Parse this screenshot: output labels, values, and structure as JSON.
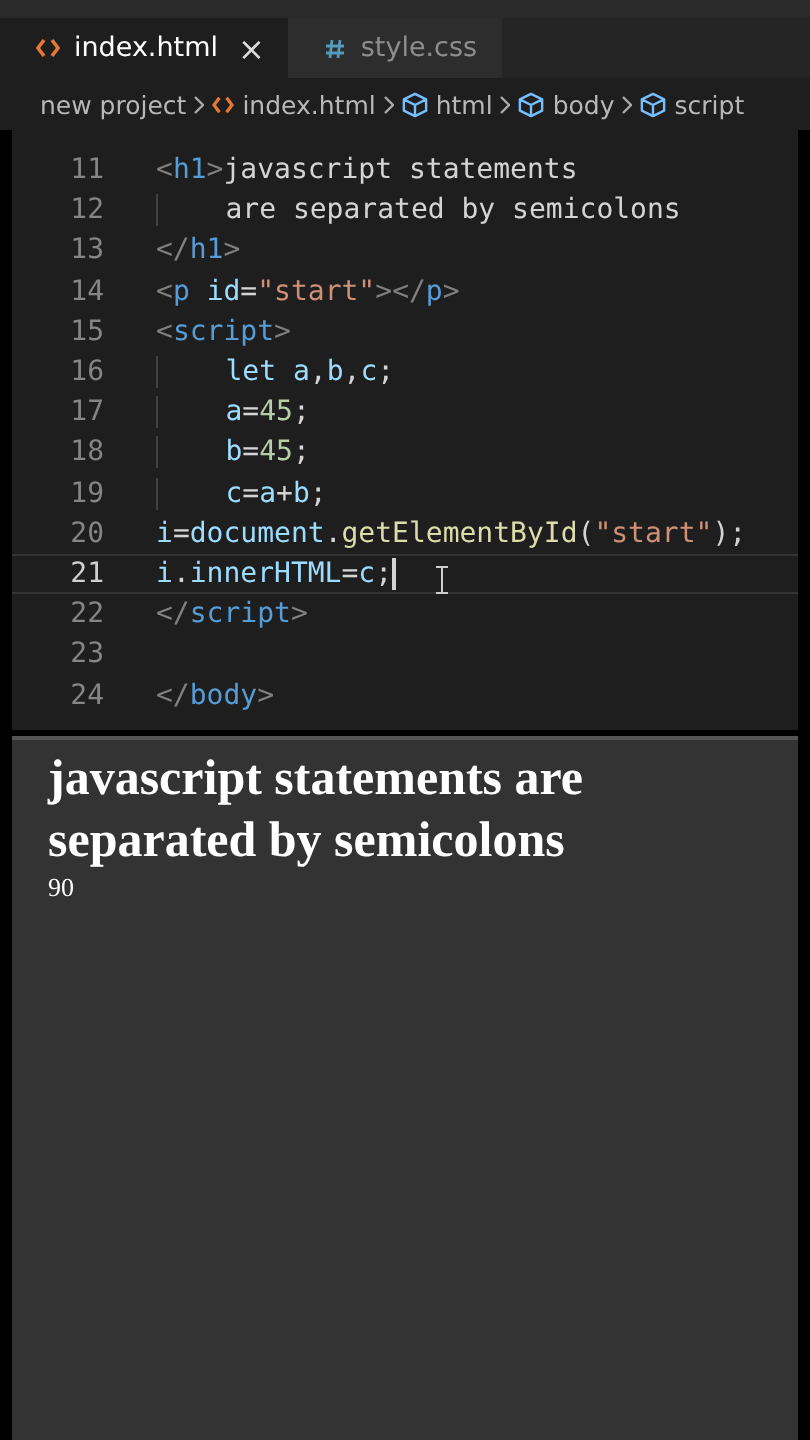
{
  "tabs": [
    {
      "label": "index.html",
      "kind": "html",
      "selected": true,
      "close": "×"
    },
    {
      "label": "style.css",
      "kind": "css",
      "selected": false
    }
  ],
  "breadcrumb": [
    {
      "label": "new project",
      "kind": "folder"
    },
    {
      "label": "index.html",
      "kind": "html"
    },
    {
      "label": "html",
      "kind": "element"
    },
    {
      "label": "body",
      "kind": "element"
    },
    {
      "label": "script",
      "kind": "element"
    }
  ],
  "code_lines": [
    {
      "number": "11",
      "kind": "html",
      "current": false,
      "text": "<h1>javascript statements"
    },
    {
      "number": "12",
      "kind": "html",
      "current": false,
      "text": "    are separated by semicolons"
    },
    {
      "number": "13",
      "kind": "html",
      "current": false,
      "text": "</h1>"
    },
    {
      "number": "14",
      "kind": "html",
      "current": false,
      "text": "<p id=\"start\"></p>"
    },
    {
      "number": "15",
      "kind": "html",
      "current": false,
      "text": "<script>"
    },
    {
      "number": "16",
      "kind": "js",
      "current": false,
      "text": "    let a,b,c;"
    },
    {
      "number": "17",
      "kind": "js",
      "current": false,
      "text": "    a=45;"
    },
    {
      "number": "18",
      "kind": "js",
      "current": false,
      "text": "    b=45;"
    },
    {
      "number": "19",
      "kind": "js",
      "current": false,
      "text": "    c=a+b;"
    },
    {
      "number": "20",
      "kind": "js",
      "current": false,
      "text": "i=document.getElementById(\"start\");"
    },
    {
      "number": "21",
      "kind": "js",
      "current": true,
      "text": "i.innerHTML=c;"
    },
    {
      "number": "22",
      "kind": "html",
      "current": false,
      "text": "</script>"
    },
    {
      "number": "23",
      "current": false
    },
    {
      "number": "24",
      "kind": "html",
      "current": false,
      "text": "</body>"
    }
  ],
  "preview": {
    "heading": "javascript statements are separated by semicolons",
    "output": "90"
  }
}
